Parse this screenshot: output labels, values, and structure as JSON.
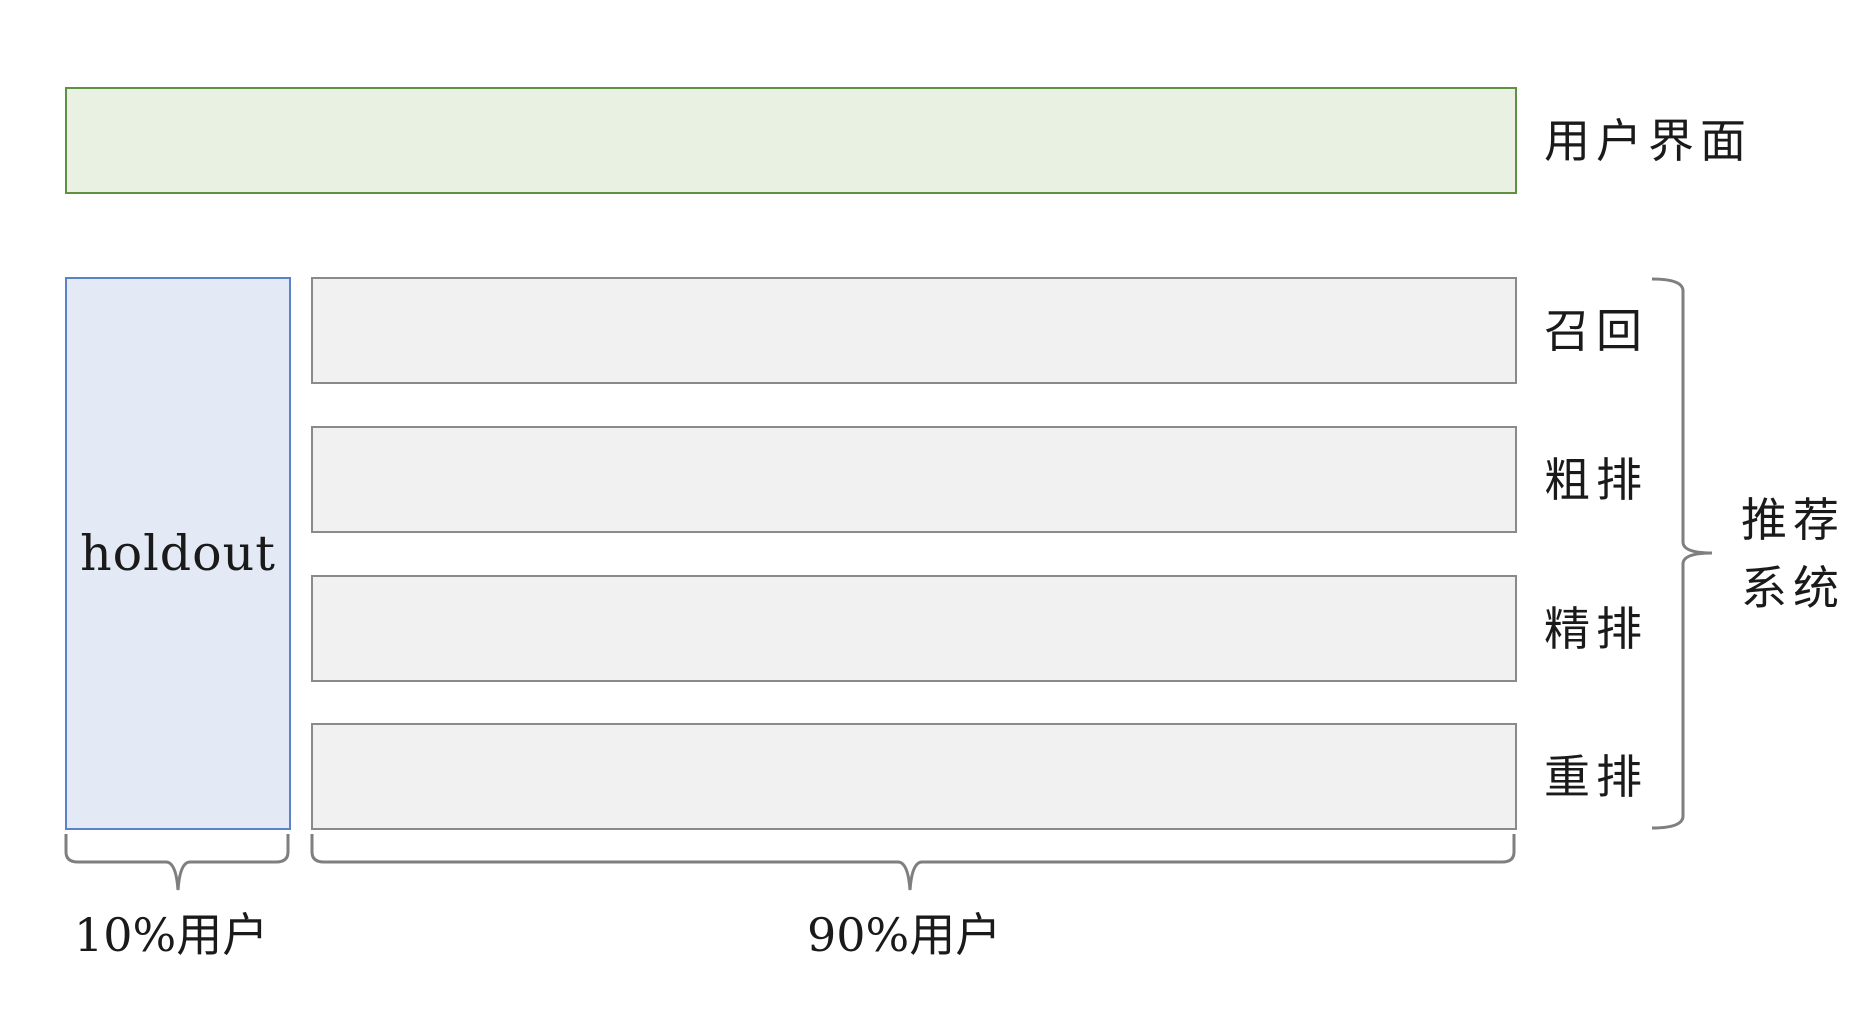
{
  "ui_layer": {
    "label": "用户界面"
  },
  "holdout": {
    "label": "holdout",
    "share_label": "10%用户"
  },
  "experiment": {
    "share_label": "90%用户"
  },
  "stages": [
    {
      "label": "召回"
    },
    {
      "label": "粗排"
    },
    {
      "label": "精排"
    },
    {
      "label": "重排"
    }
  ],
  "system": {
    "label_line1": "推荐",
    "label_line2": "系统"
  },
  "colors": {
    "ui_fill": "#e9f2e2",
    "ui_border": "#5f9240",
    "holdout_fill": "#e3e9f5",
    "holdout_border": "#5b81c9",
    "stage_fill": "#f1f1f1",
    "stage_border": "#8a8a8a",
    "brace": "#7f7f7f"
  }
}
